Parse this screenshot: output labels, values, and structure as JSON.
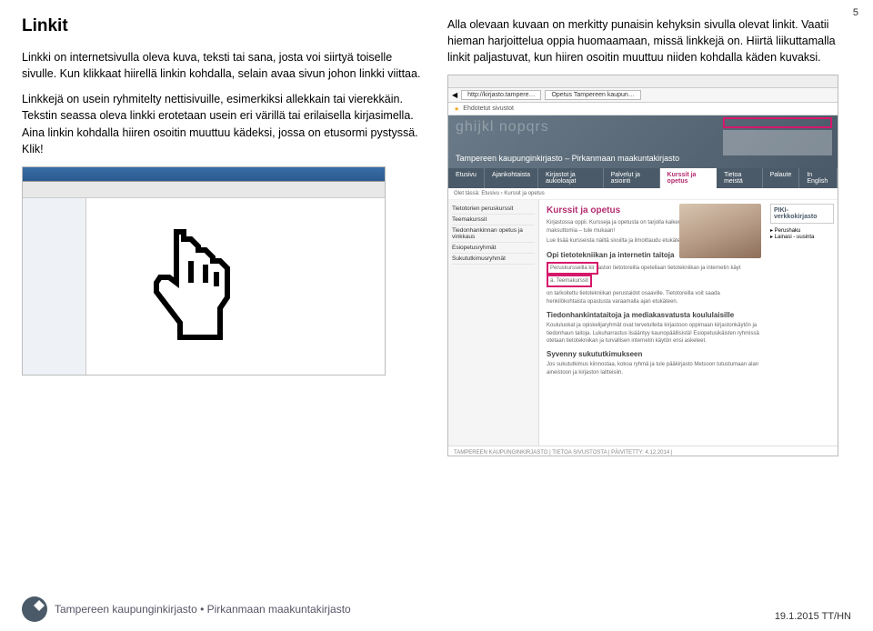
{
  "pageNumber": "5",
  "heading": "Linkit",
  "leftParagraphs": [
    "Linkki on internetsivulla oleva kuva, teksti tai sana, josta voi siirtyä toiselle sivulle. Kun klikkaat hiirellä linkin kohdalla, selain avaa sivun johon linkki viittaa.",
    "Linkkejä on usein ryhmitelty nettisivuille, esimerkiksi allekkain tai vierekkäin. Tekstin seassa oleva linkki erotetaan usein eri värillä tai erilaisella kirjasimella. Aina linkin kohdalla hiiren osoitin muuttuu kädeksi, jossa on etusormi pystyssä. Klik!"
  ],
  "rightParagraphs": [
    "Alla olevaan kuvaan on merkitty punaisin kehyksin sivulla olevat linkit. Vaatii hieman harjoittelua oppia huomaamaan, missä linkkejä on. Hiirtä liikuttamalla linkit paljastuvat, kun hiiren osoitin muuttuu niiden kohdalla käden kuvaksi."
  ],
  "rightShot": {
    "addrTab1": "http://kirjasto.tampere…",
    "addrTab2": "Opetus Tampereen kaupun…",
    "suggested": "Ehdotetut sivustot",
    "bannerLetters": "ghijkl nopqrs",
    "brand": "Tampereen kaupunginkirjasto – Pirkanmaan maakuntakirjasto",
    "tabs": [
      "Etusivu",
      "Ajankohtaista",
      "Kirjastot ja aukioloajat",
      "Palvelut ja asiointi",
      "Kurssit ja opetus",
      "Tietoa meistä",
      "Palaute",
      "In English"
    ],
    "breadcrumb": "Olet tässä:  Etusivu ›  Kurssit ja opetus",
    "sideItems": [
      "Tietotorien peruskurssit",
      "Teemakurssit",
      "Tiedonhankinnan opetus ja vinkkaus",
      "Esiopetusryhmät",
      "Sukututkimusryhmät"
    ],
    "piki": "PIKI-verkkokirjasto",
    "pikiSub": [
      "▸ Perushaku",
      "▸ Lainasi - uusinta"
    ],
    "h3": "Kurssit ja opetus",
    "body1": "Kirjastossa oppii. Kursseja ja opetusta on tarjolla kaikenikäisille. Kurssit ovat maksuttomia – tule mukaan!",
    "body2": "Lue lisää kursseista näiltä sivuilta ja ilmoittaudu etukäteen puhelimitse tai paikan päällä.",
    "h4a": "Opi tietotekniikan ja internetin taitoja",
    "hl2a": "Peruskursseilla kir",
    "hl2b": "aston tietotoreilla opetellaan tietotekniikan ja internetin käyt",
    "hl2c": "ä. Teemakurssit",
    "body3": "on tarkoitettu tietotekniikan perustaidot osaaville. Tietotoreilla voit saada henkilökohtaista opastusta varaamalla ajan etukäteen.",
    "h4b": "Tiedonhankintataitoja ja mediakasvatusta koululaisille",
    "body4": "Koululuokat ja opiskelijaryhmät ovat tervetulleita kirjastoon oppimaan kirjastonkäytön ja tiedonhaun taitoja. Lukuharrastus lisääntyy kaunopäällisistä! Esiopetusikäisten ryhmissä otetaan tietotekniikan ja turvallisen internetin käytön ensi askeleet.",
    "h4c": "Syvenny sukututkimukseen",
    "body5": "Jos sukututkimus kiinnostaa, kokoa ryhmä ja tule pääkirjasto Metsoon tutustumaan alan aineistoon ja kirjaston laitteisiin.",
    "footer": "TAMPEREEN KAUPUNGINKIRJASTO  |  TIETOA SIVUSTOSTA  |  PÄIVITETTY: 4.12.2014 |"
  },
  "footerBrand": "Tampereen kaupunginkirjasto • Pirkanmaan maakuntakirjasto",
  "docDate": "19.1.2015 TT/HN"
}
